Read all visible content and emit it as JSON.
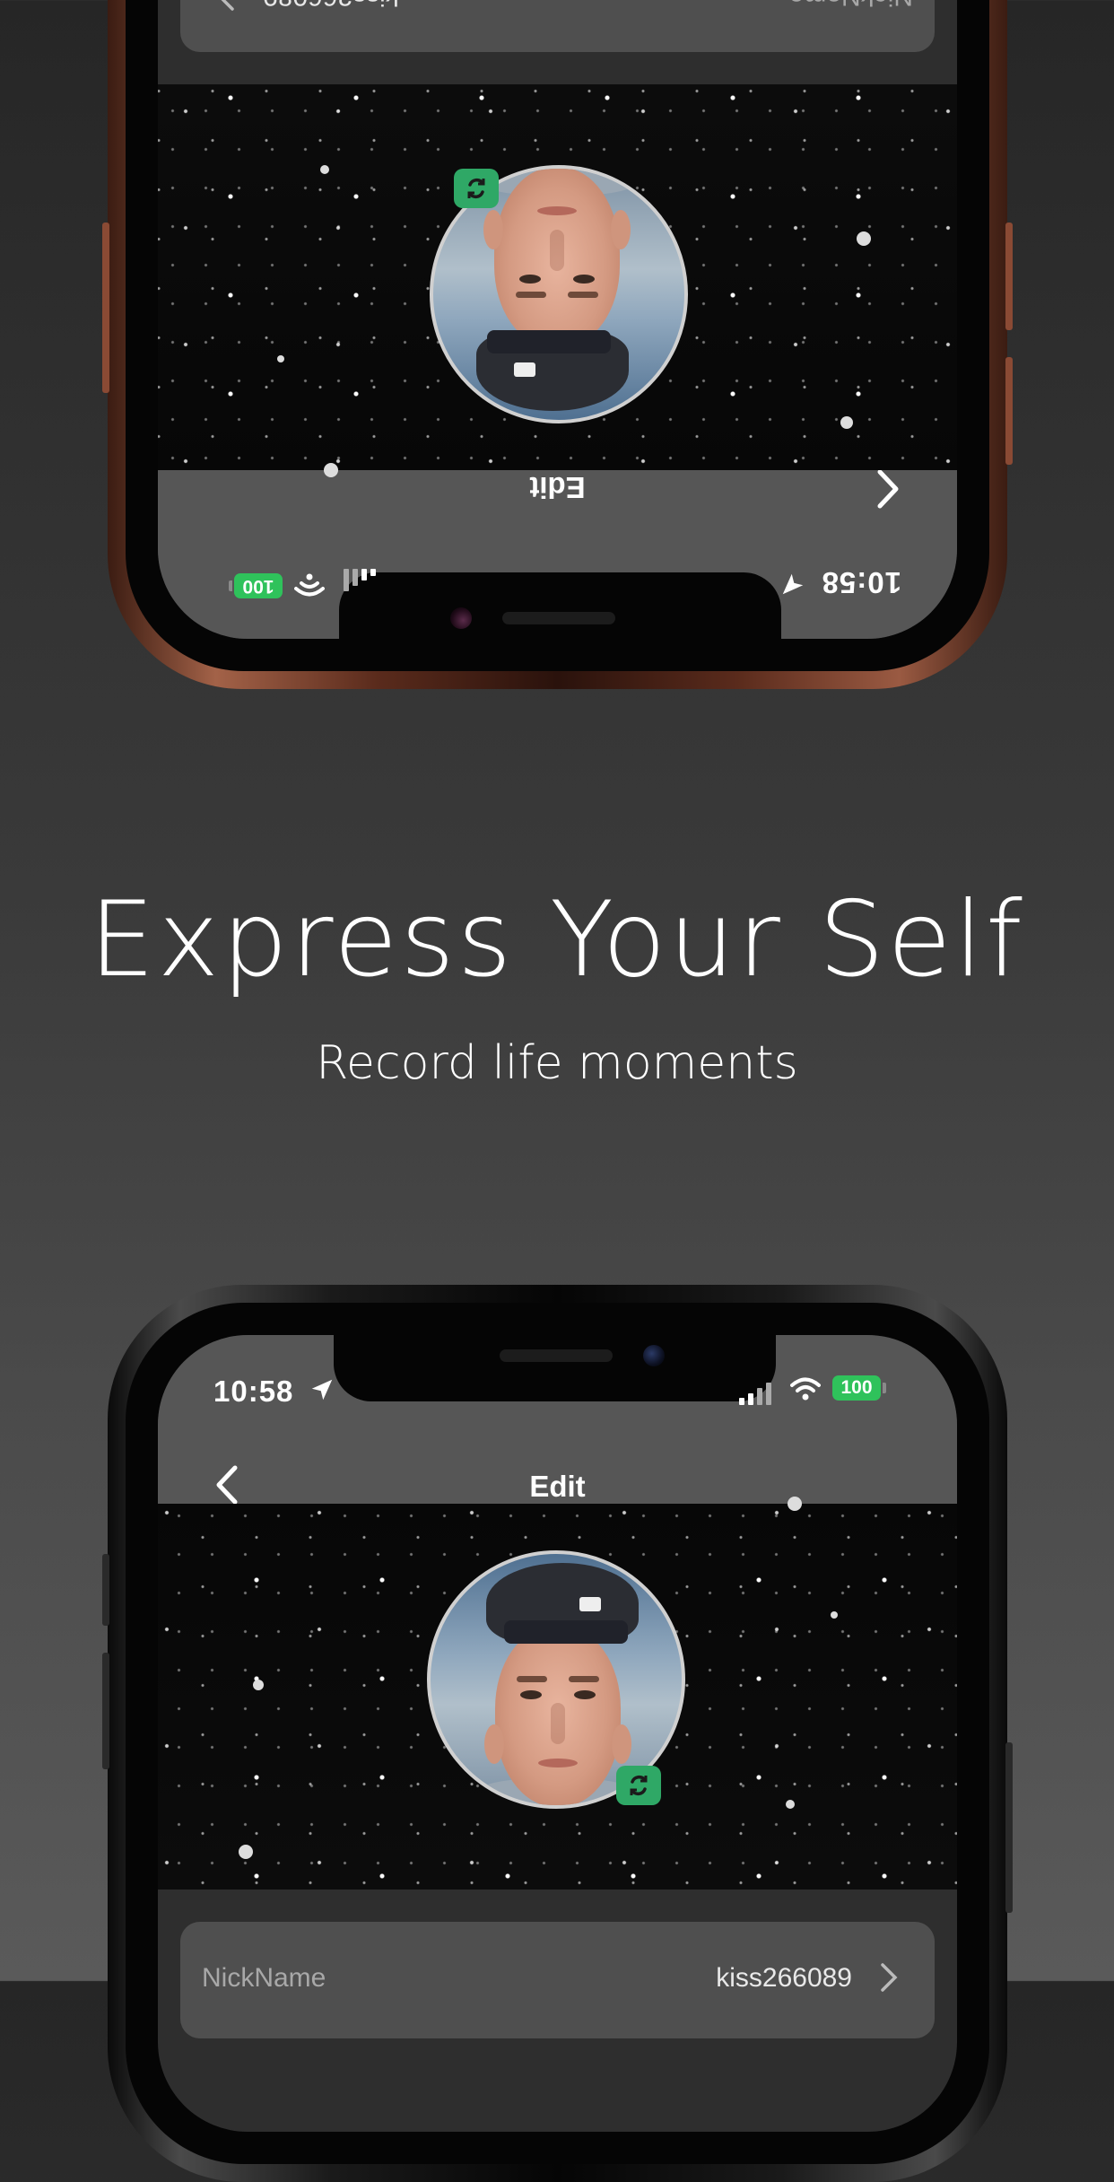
{
  "hero": {
    "title": "Express Your Self",
    "subtitle": "Record life moments"
  },
  "phone": {
    "status": {
      "time": "10:58",
      "battery": "100",
      "icons": [
        "location-arrow-icon",
        "signal-icon",
        "wifi-icon",
        "battery-icon"
      ]
    },
    "nav": {
      "title": "Edit",
      "back_icon": "chevron-left-icon"
    },
    "avatar": {
      "badge_icon": "camera-switch-icon",
      "badge_color": "#2fa866"
    },
    "profile_rows": [
      {
        "label": "NickName",
        "value": "kiss266089",
        "icon": "chevron-right-icon"
      }
    ]
  },
  "colors": {
    "accent": "#2fc25b",
    "nav_bar": "#565656",
    "frame_top": "#9a5a42",
    "frame_bottom": "#1a1a1a"
  }
}
